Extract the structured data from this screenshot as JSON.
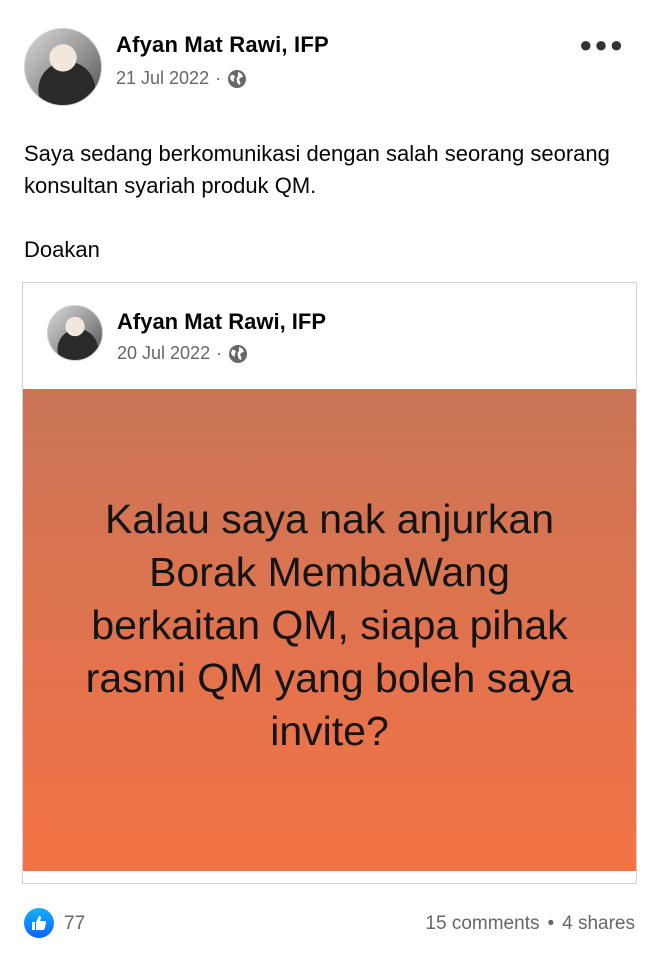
{
  "post": {
    "author": "Afyan Mat Rawi, IFP",
    "date": "21 Jul 2022",
    "separator": "·",
    "text_line1": "Saya sedang berkomunikasi dengan salah seorang seorang konsultan syariah  produk QM.",
    "text_line2": "Doakan",
    "more_icon": "more-horizontal-icon",
    "privacy_icon": "globe-icon"
  },
  "shared": {
    "author": "Afyan Mat Rawi, IFP",
    "date": "20 Jul 2022",
    "separator": "·",
    "message": "Kalau saya nak anjurkan Borak MembaWang berkaitan QM, siapa pihak rasmi QM yang boleh saya invite?",
    "privacy_icon": "globe-icon",
    "bg_colors": [
      "#c97556",
      "#f47345"
    ]
  },
  "footer": {
    "reaction_icon": "like-icon",
    "like_count": "77",
    "comments": "15 comments",
    "dot": "•",
    "shares": "4 shares"
  },
  "colors": {
    "like_blue": "#0866ff",
    "meta_gray": "#65676b"
  }
}
